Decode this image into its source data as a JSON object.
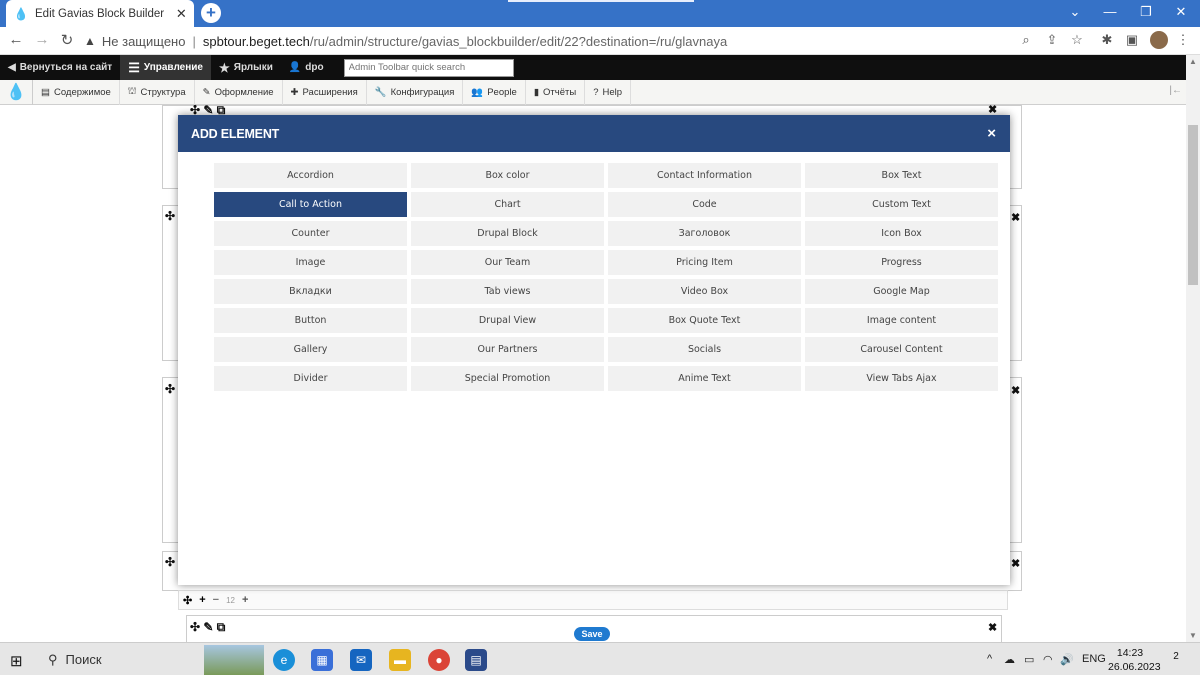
{
  "browser": {
    "tab_title": "Edit Gavias Block Builder | Север",
    "url_security": "Не защищено",
    "url_host": "spbtour.beget.tech",
    "url_path": "/ru/admin/structure/gavias_blockbuilder/edit/22?destination=/ru/glavnaya"
  },
  "admin_toolbar": {
    "back": "Вернуться на сайт",
    "manage": "Управление",
    "shortcuts": "Ярлыки",
    "user": "dpo",
    "search_placeholder": "Admin Toolbar quick search"
  },
  "tray": {
    "items": [
      "Содержимое",
      "Структура",
      "Оформление",
      "Расширения",
      "Конфигурация",
      "People",
      "Отчёты",
      "Help"
    ]
  },
  "modal": {
    "title": "ADD ELEMENT",
    "close": "×",
    "elements": [
      "Accordion",
      "Box color",
      "Contact Information",
      "Box Text",
      "Call to Action",
      "Chart",
      "Code",
      "Custom Text",
      "Counter",
      "Drupal Block",
      "Заголовок",
      "Icon Box",
      "Image",
      "Our Team",
      "Pricing Item",
      "Progress",
      "Вкладки",
      "Tab views",
      "Video Box",
      "Google Map",
      "Button",
      "Drupal View",
      "Box Quote Text",
      "Image content",
      "Gallery",
      "Our Partners",
      "Socials",
      "Carousel Content",
      "Divider",
      "Special Promotion",
      "Anime Text",
      "View Tabs Ajax"
    ],
    "selected": "Call to Action"
  },
  "builder": {
    "column_size": "12",
    "save_label": "Save"
  },
  "taskbar": {
    "search_label": "Поиск",
    "lang": "ENG",
    "time": "14:23",
    "date": "26.06.2023",
    "notifications": "2"
  }
}
